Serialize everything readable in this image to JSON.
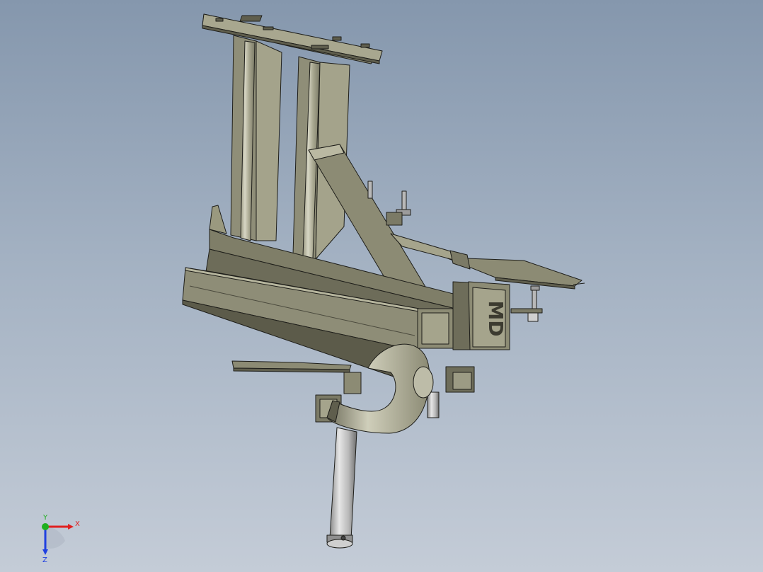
{
  "viewport": {
    "colors": {
      "background_top": "#8597ad",
      "background_bottom": "#c4ccd7",
      "part_main": "#8c8b74",
      "part_light": "#b6b59c",
      "part_dark": "#5f5e4d",
      "shaft": "#c9c9c9",
      "edge": "#1e1e1a"
    },
    "model": {
      "logo_text": "MD"
    }
  },
  "triad": {
    "x_label": "X",
    "y_label": "Y",
    "z_label": "Z",
    "x_color": "#e02020",
    "y_color": "#20b020",
    "z_color": "#2040e0"
  }
}
